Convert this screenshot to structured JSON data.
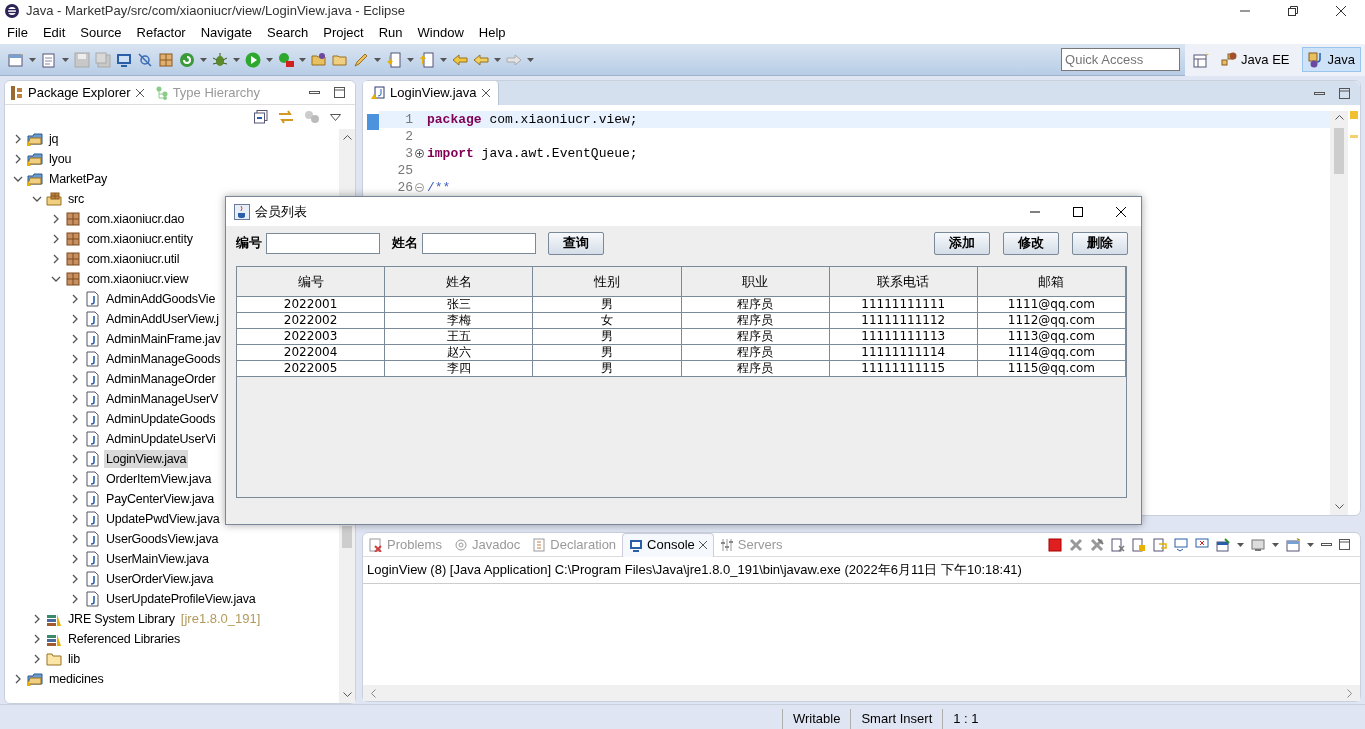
{
  "window": {
    "title": "Java - MarketPay/src/com/xiaoniucr/view/LoginView.java - Eclipse"
  },
  "menu": [
    "File",
    "Edit",
    "Source",
    "Refactor",
    "Navigate",
    "Search",
    "Project",
    "Run",
    "Window",
    "Help"
  ],
  "quick_access": {
    "placeholder": "Quick Access"
  },
  "perspectives": [
    {
      "label": "Java EE",
      "selected": false
    },
    {
      "label": "Java",
      "selected": true
    }
  ],
  "explorer": {
    "tabs": [
      {
        "label": "Package Explorer",
        "selected": true
      },
      {
        "label": "Type Hierarchy",
        "selected": false
      }
    ],
    "tree": [
      {
        "label": "jq",
        "kind": "project",
        "expanded": false,
        "selected": false
      },
      {
        "label": "lyou",
        "kind": "project",
        "expanded": false,
        "selected": false
      },
      {
        "label": "MarketPay",
        "kind": "project",
        "expanded": true,
        "selected": false,
        "children": [
          {
            "label": "src",
            "kind": "source",
            "expanded": true,
            "selected": false,
            "children": [
              {
                "label": "com.xiaoniucr.dao",
                "kind": "package",
                "expanded": false,
                "selected": false
              },
              {
                "label": "com.xiaoniucr.entity",
                "kind": "package",
                "expanded": false,
                "selected": false
              },
              {
                "label": "com.xiaoniucr.util",
                "kind": "package",
                "expanded": false,
                "selected": false
              },
              {
                "label": "com.xiaoniucr.view",
                "kind": "package",
                "expanded": true,
                "selected": false,
                "children": [
                  {
                    "label": "AdminAddGoodsVie",
                    "kind": "file",
                    "expanded": false,
                    "selected": false
                  },
                  {
                    "label": "AdminAddUserView.j",
                    "kind": "file",
                    "expanded": false,
                    "selected": false
                  },
                  {
                    "label": "AdminMainFrame.jav",
                    "kind": "file",
                    "expanded": false,
                    "selected": false
                  },
                  {
                    "label": "AdminManageGoods",
                    "kind": "file",
                    "expanded": false,
                    "selected": false
                  },
                  {
                    "label": "AdminManageOrder",
                    "kind": "file",
                    "expanded": false,
                    "selected": false
                  },
                  {
                    "label": "AdminManageUserV",
                    "kind": "file",
                    "expanded": false,
                    "selected": false
                  },
                  {
                    "label": "AdminUpdateGoods",
                    "kind": "file",
                    "expanded": false,
                    "selected": false
                  },
                  {
                    "label": "AdminUpdateUserVi",
                    "kind": "file",
                    "expanded": false,
                    "selected": false
                  },
                  {
                    "label": "LoginView.java",
                    "kind": "file",
                    "expanded": false,
                    "selected": true
                  },
                  {
                    "label": "OrderItemView.java",
                    "kind": "file",
                    "expanded": false,
                    "selected": false
                  },
                  {
                    "label": "PayCenterView.java",
                    "kind": "file",
                    "expanded": false,
                    "selected": false
                  },
                  {
                    "label": "UpdatePwdView.java",
                    "kind": "file",
                    "expanded": false,
                    "selected": false
                  },
                  {
                    "label": "UserGoodsView.java",
                    "kind": "file",
                    "expanded": false,
                    "selected": false
                  },
                  {
                    "label": "UserMainView.java",
                    "kind": "file",
                    "expanded": false,
                    "selected": false
                  },
                  {
                    "label": "UserOrderView.java",
                    "kind": "file",
                    "expanded": false,
                    "selected": false
                  },
                  {
                    "label": "UserUpdateProfileView.java",
                    "kind": "file",
                    "expanded": false,
                    "selected": false
                  }
                ]
              }
            ]
          },
          {
            "label": "JRE System Library",
            "suffix": "[jre1.8.0_191]",
            "kind": "library",
            "expanded": false,
            "selected": false
          },
          {
            "label": "Referenced Libraries",
            "kind": "library",
            "expanded": false,
            "selected": false
          },
          {
            "label": "lib",
            "kind": "folder",
            "expanded": false,
            "selected": false
          }
        ]
      },
      {
        "label": "medicines",
        "kind": "project",
        "expanded": false,
        "selected": false
      }
    ]
  },
  "editor": {
    "tabs": [
      {
        "label": "LoginView.java",
        "selected": true
      }
    ],
    "lines": [
      {
        "number": "1",
        "current": true,
        "tokens": [
          {
            "kind": "keyword",
            "text": "package"
          },
          {
            "kind": "plain",
            "text": " com.xiaoniucr.view;"
          }
        ]
      },
      {
        "number": "2",
        "current": false
      },
      {
        "number": "3",
        "current": false,
        "folded": true,
        "tokens": [
          {
            "kind": "keyword",
            "text": "import"
          },
          {
            "kind": "plain",
            "text": " java.awt.EventQueue;"
          }
        ]
      },
      {
        "number": "25",
        "current": false
      },
      {
        "number": "26",
        "current": false,
        "folded": false,
        "tokens": [
          {
            "kind": "comment",
            "text": "/**"
          }
        ]
      }
    ]
  },
  "console": {
    "tabs": [
      {
        "label": "Problems",
        "selected": false
      },
      {
        "label": "Javadoc",
        "selected": false
      },
      {
        "label": "Declaration",
        "selected": false
      },
      {
        "label": "Console",
        "selected": true
      },
      {
        "label": "Servers",
        "selected": false
      }
    ],
    "header": "LoginView (8) [Java Application] C:\\Program Files\\Java\\jre1.8.0_191\\bin\\javaw.exe (2022年6月11日 下午10:18:41)"
  },
  "status_bar": [
    "Writable",
    "Smart Insert",
    "1 : 1"
  ],
  "dialog": {
    "title": "会员列表",
    "fields": [
      {
        "label": "编号"
      },
      {
        "label": "姓名"
      }
    ],
    "search_button": "查询",
    "actions": [
      "添加",
      "修改",
      "删除"
    ],
    "table": {
      "columns": [
        "编号",
        "姓名",
        "性别",
        "职业",
        "联系电话",
        "邮箱"
      ],
      "rows": [
        [
          "2022001",
          "张三",
          "男",
          "程序员",
          "11111111111",
          "1111@qq.com"
        ],
        [
          "2022002",
          "李梅",
          "女",
          "程序员",
          "11111111112",
          "1112@qq.com"
        ],
        [
          "2022003",
          "王五",
          "男",
          "程序员",
          "11111111113",
          "1113@qq.com"
        ],
        [
          "2022004",
          "赵六",
          "男",
          "程序员",
          "11111111114",
          "1114@qq.com"
        ],
        [
          "2022005",
          "李四",
          "男",
          "程序员",
          "11111111115",
          "1115@qq.com"
        ]
      ]
    }
  }
}
